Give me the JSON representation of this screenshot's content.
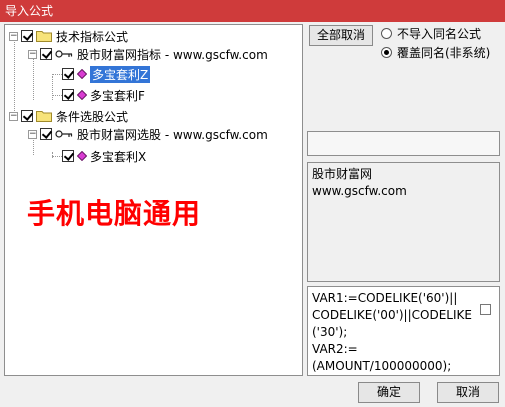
{
  "window": {
    "title": "导入公式"
  },
  "tree": {
    "groups": [
      {
        "label": "技术指标公式",
        "expander": "−",
        "checked": true,
        "children": [
          {
            "label": "股市财富网指标 - www.gscfw.com",
            "expander": "−",
            "checked": true,
            "items": [
              {
                "label": "多宝套利Z",
                "checked": true,
                "selected": true
              },
              {
                "label": "多宝套利F",
                "checked": true,
                "selected": false
              }
            ]
          }
        ]
      },
      {
        "label": "条件选股公式",
        "expander": "−",
        "checked": true,
        "children": [
          {
            "label": "股市财富网选股 - www.gscfw.com",
            "expander": "−",
            "checked": true,
            "items": [
              {
                "label": "多宝套利X",
                "checked": true,
                "selected": false
              }
            ]
          }
        ]
      }
    ]
  },
  "banner": {
    "text": "手机电脑通用"
  },
  "controls": {
    "cancel_all_label": "全部取消",
    "radio_no_import": "不导入同名公式",
    "radio_overwrite": "覆盖同名(非系统)",
    "selected_radio": "overwrite"
  },
  "info": {
    "line1": "股市财富网",
    "line2": "www.gscfw.com"
  },
  "code": {
    "lines": [
      "VAR1:=CODELIKE('60')||",
      "CODELIKE('00')||CODELIKE",
      "('30');",
      "VAR2:=",
      "(AMOUNT/100000000);"
    ]
  },
  "footer": {
    "ok_label": "确定",
    "cancel_label": "取消"
  },
  "colors": {
    "titlebar": "#cf3b3b",
    "selection": "#3375d7",
    "banner": "#ff0000"
  }
}
